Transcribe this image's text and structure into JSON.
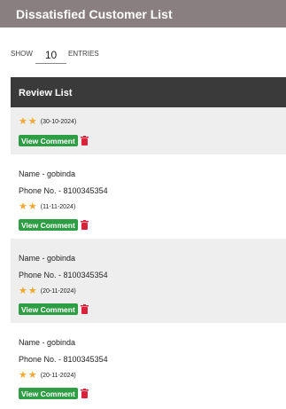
{
  "header": {
    "title": "Dissatisfied Customer List"
  },
  "entries": {
    "show_label": "SHOW",
    "value": "10",
    "entries_label": "ENTRIES"
  },
  "list": {
    "title": "Review List"
  },
  "reviews": [
    {
      "stars": 2,
      "date": "(30-10-2024)",
      "view_label": "View Comment"
    },
    {
      "name": "Name - gobinda",
      "phone": "Phone No. - 8100345354",
      "stars": 2,
      "date": "(11-11-2024)",
      "view_label": "View Comment"
    },
    {
      "name": "Name - gobinda",
      "phone": "Phone No. - 8100345354",
      "stars": 2,
      "date": "(20-11-2024)",
      "view_label": "View Comment"
    },
    {
      "name": "Name - gobinda",
      "phone": "Phone No. - 8100345354",
      "stars": 2,
      "date": "(20-11-2024)",
      "view_label": "View Comment"
    }
  ],
  "icons": {
    "star": "star-icon",
    "delete": "trash-icon"
  },
  "colors": {
    "titlebar": "#8a7f80",
    "header": "#3a3a3a",
    "star": "#f0a830",
    "button": "#2e9e44",
    "delete": "#d9233b",
    "shaded_row": "#eeeeee"
  }
}
